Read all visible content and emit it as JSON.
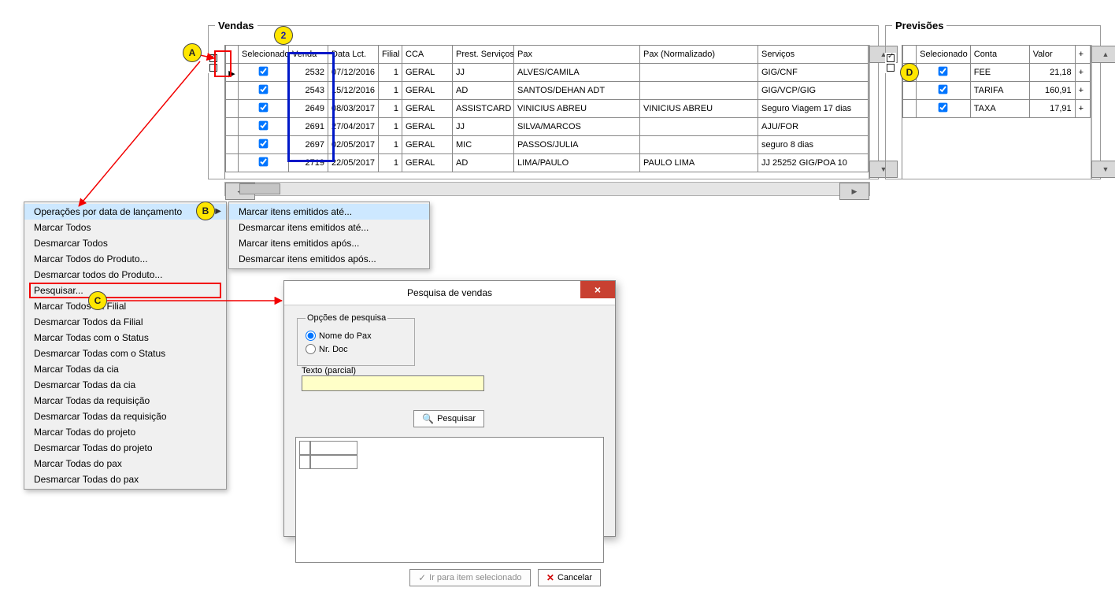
{
  "panels": {
    "vendas_title": "Vendas",
    "previsoes_title": "Previsões"
  },
  "vendas": {
    "columns": [
      "Selecionado",
      "Venda",
      "Data Lct.",
      "Filial",
      "CCA",
      "Prest. Serviços",
      "Pax",
      "Pax (Normalizado)",
      "Serviços"
    ],
    "rows": [
      {
        "sel": true,
        "venda": "2532",
        "data": "07/12/2016",
        "filial": "1",
        "cca": "GERAL",
        "prest": "JJ",
        "pax": "ALVES/CAMILA",
        "paxn": "",
        "serv": "GIG/CNF"
      },
      {
        "sel": true,
        "venda": "2543",
        "data": "15/12/2016",
        "filial": "1",
        "cca": "GERAL",
        "prest": "AD",
        "pax": "SANTOS/DEHAN ADT",
        "paxn": "",
        "serv": "GIG/VCP/GIG"
      },
      {
        "sel": true,
        "venda": "2649",
        "data": "08/03/2017",
        "filial": "1",
        "cca": "GERAL",
        "prest": "ASSISTCARD",
        "pax": "VINICIUS ABREU",
        "paxn": "VINICIUS ABREU",
        "serv": "Seguro Viagem 17 dias"
      },
      {
        "sel": true,
        "venda": "2691",
        "data": "27/04/2017",
        "filial": "1",
        "cca": "GERAL",
        "prest": "JJ",
        "pax": "SILVA/MARCOS",
        "paxn": "",
        "serv": "AJU/FOR"
      },
      {
        "sel": true,
        "venda": "2697",
        "data": "02/05/2017",
        "filial": "1",
        "cca": "GERAL",
        "prest": "MIC",
        "pax": "PASSOS/JULIA",
        "paxn": "",
        "serv": "seguro 8 dias"
      },
      {
        "sel": true,
        "venda": "2719",
        "data": "22/05/2017",
        "filial": "1",
        "cca": "GERAL",
        "prest": "AD",
        "pax": "LIMA/PAULO",
        "paxn": "PAULO LIMA",
        "serv": "JJ 25252 GIG/POA 10"
      }
    ]
  },
  "previsoes": {
    "columns": [
      "Selecionado",
      "Conta",
      "Valor",
      "+"
    ],
    "rows": [
      {
        "sel": true,
        "conta": "FEE",
        "valor": "21,18",
        "plus": "+"
      },
      {
        "sel": true,
        "conta": "TARIFA",
        "valor": "160,91",
        "plus": "+"
      },
      {
        "sel": true,
        "conta": "TAXA",
        "valor": "17,91",
        "plus": "+"
      }
    ]
  },
  "menu_main": [
    "Operações por data de lançamento",
    "Marcar Todos",
    "Desmarcar Todos",
    "Marcar Todos do Produto...",
    "Desmarcar todos do Produto...",
    "Pesquisar...",
    "Marcar Todos da Filial",
    "Desmarcar Todos da Filial",
    "Marcar Todas com o Status",
    "Desmarcar Todas com o Status",
    "Marcar Todas da cia",
    "Desmarcar Todas da cia",
    "Marcar Todas da requisição",
    "Desmarcar Todas da requisição",
    "Marcar Todas do projeto",
    "Desmarcar Todas do projeto",
    "Marcar Todas do pax",
    "Desmarcar Todas do pax"
  ],
  "menu_sub": [
    "Marcar itens emitidos até...",
    "Desmarcar itens emitidos até...",
    "Marcar itens emitidos após...",
    "Desmarcar itens emitidos após..."
  ],
  "dialog": {
    "title": "Pesquisa de vendas",
    "opts_legend": "Opções de pesquisa",
    "radio_pax": "Nome do Pax",
    "radio_doc": "Nr. Doc",
    "texto_label": "Texto (parcial)",
    "texto_value": "",
    "btn_pesquisar": "Pesquisar",
    "btn_ir": "Ir para item selecionado",
    "btn_cancelar": "Cancelar"
  },
  "badges": {
    "A": "A",
    "B": "B",
    "C": "C",
    "D": "D",
    "two": "2"
  }
}
